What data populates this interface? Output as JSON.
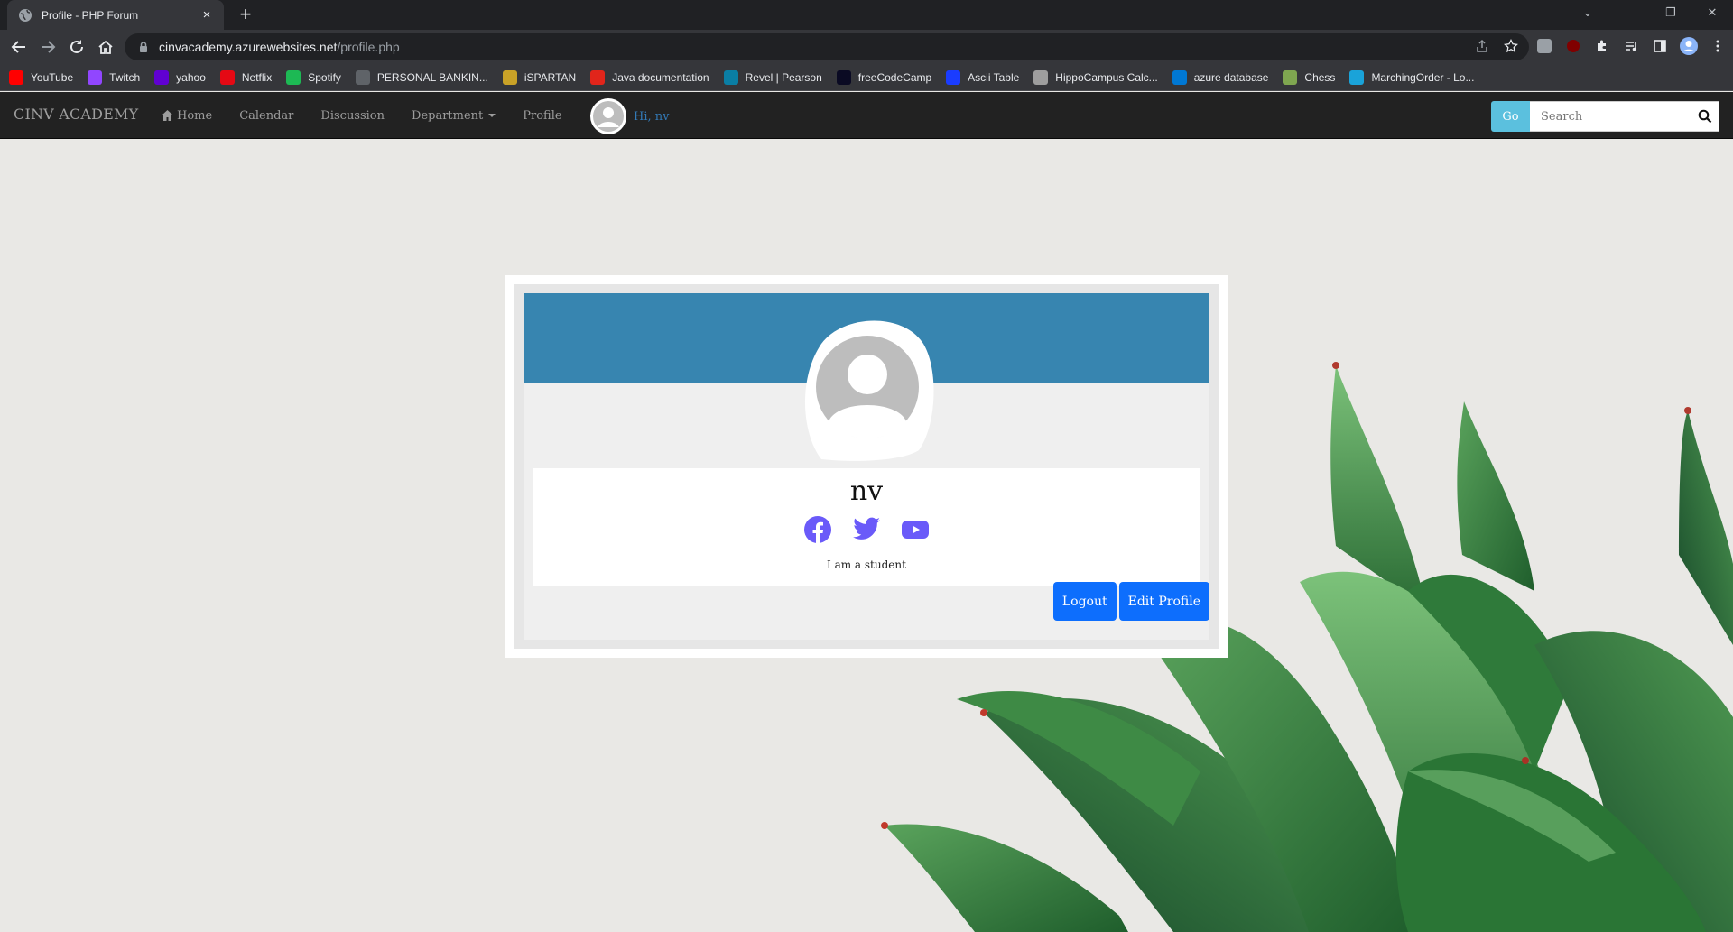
{
  "browser": {
    "tab_title": "Profile - PHP Forum",
    "tab_close": "×",
    "new_tab": "+",
    "url_host": "cinvacademy.azurewebsites.net",
    "url_path": "/profile.php",
    "window_controls": {
      "collapse": "⌄",
      "minimize": "—",
      "restore": "❐",
      "close": "✕"
    },
    "bookmarks": [
      {
        "label": "YouTube",
        "icon": "youtube-icon",
        "color": "#ff0000"
      },
      {
        "label": "Twitch",
        "icon": "twitch-icon",
        "color": "#9146ff"
      },
      {
        "label": "yahoo",
        "icon": "yahoo-icon",
        "color": "#6001d2"
      },
      {
        "label": "Netflix",
        "icon": "netflix-icon",
        "color": "#e50914"
      },
      {
        "label": "Spotify",
        "icon": "spotify-icon",
        "color": "#1db954"
      },
      {
        "label": "PERSONAL BANKIN...",
        "icon": "globe-icon",
        "color": "#5f6368"
      },
      {
        "label": "iSPARTAN",
        "icon": "spartan-icon",
        "color": "#c9a227"
      },
      {
        "label": "Java documentation",
        "icon": "oracle-icon",
        "color": "#e1251b"
      },
      {
        "label": "Revel | Pearson",
        "icon": "pearson-icon",
        "color": "#0a7ea4"
      },
      {
        "label": "freeCodeCamp",
        "icon": "freecodecamp-icon",
        "color": "#0a0a23"
      },
      {
        "label": "Ascii Table",
        "icon": "ascii-icon",
        "color": "#1a3cff"
      },
      {
        "label": "HippoCampus Calc...",
        "icon": "hippo-icon",
        "color": "#9e9e9e"
      },
      {
        "label": "azure database",
        "icon": "azure-icon",
        "color": "#0078d4"
      },
      {
        "label": "Chess",
        "icon": "chess-icon",
        "color": "#7fa650"
      },
      {
        "label": "MarchingOrder - Lo...",
        "icon": "marchingorder-icon",
        "color": "#1aa3d9"
      }
    ]
  },
  "site": {
    "brand": "CINV ACADEMY",
    "nav": {
      "home": "Home",
      "calendar": "Calendar",
      "discussion": "Discussion",
      "department": "Department",
      "profile": "Profile"
    },
    "greeting": "Hi, nv",
    "search": {
      "button": "Go",
      "placeholder": "Search"
    },
    "colors": {
      "navbar": "#222222",
      "go_button": "#5bc0de",
      "greeting": "#337ab7"
    }
  },
  "profile": {
    "name": "nv",
    "bio": "I am a student",
    "socials": [
      "facebook-icon",
      "twitter-icon",
      "youtube-icon"
    ],
    "social_color": "#6a5af9",
    "banner_color": "#3785b0",
    "logout": "Logout",
    "edit": "Edit Profile",
    "button_color": "#0d6efd"
  }
}
